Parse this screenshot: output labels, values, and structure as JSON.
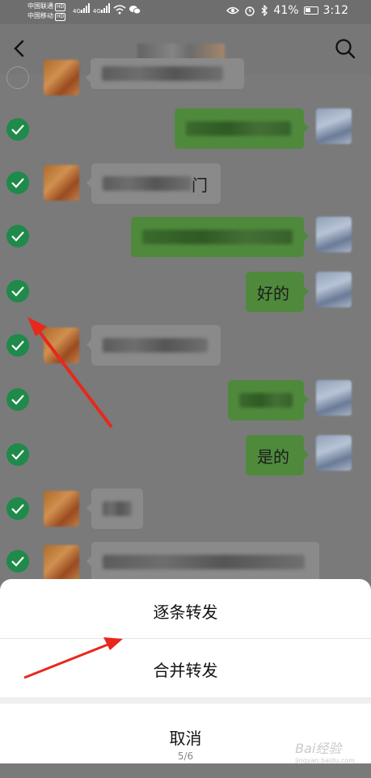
{
  "status_bar": {
    "carrier1": "中国联通",
    "carrier2": "中国移动",
    "hd": "HD",
    "net": "4G",
    "battery_pct": "41%",
    "time": "3:12",
    "icons": [
      "signal-icon",
      "wifi-icon",
      "wechat-icon",
      "eye-icon",
      "alarm-icon",
      "bluetooth-icon",
      "battery-icon"
    ]
  },
  "nav": {
    "back_icon": "chevron-left-icon",
    "search_icon": "search-icon"
  },
  "messages": [
    {
      "side": "in",
      "text": "",
      "checked": false
    },
    {
      "side": "out",
      "text": "",
      "checked": true
    },
    {
      "side": "in",
      "text": "门",
      "checked": true
    },
    {
      "side": "out",
      "text": "",
      "checked": true
    },
    {
      "side": "out",
      "text": "好的",
      "checked": true
    },
    {
      "side": "in",
      "text": "",
      "checked": true
    },
    {
      "side": "out",
      "text": "",
      "checked": true
    },
    {
      "side": "out",
      "text": "是的",
      "checked": true
    },
    {
      "side": "in",
      "text": "",
      "checked": true
    },
    {
      "side": "in",
      "text": "",
      "checked": true
    }
  ],
  "sheet": {
    "option1": "逐条转发",
    "option2": "合并转发",
    "cancel": "取消",
    "page": "5/6"
  },
  "watermark": {
    "brand": "Bai经验",
    "url": "jingyan.baidu.com"
  },
  "colors": {
    "check_green": "#1f8a4a",
    "out_bubble": "#4f8a3c",
    "arrow_red": "#e8281c"
  }
}
